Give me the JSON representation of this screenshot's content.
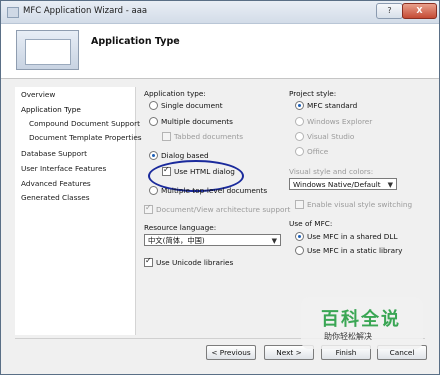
{
  "window": {
    "title": "MFC Application Wizard - aaa",
    "help_label": "?",
    "close_label": "X"
  },
  "header": {
    "title": "Application Type"
  },
  "nav": {
    "items": [
      {
        "label": "Overview"
      },
      {
        "label": "Application Type"
      },
      {
        "label": "Compound Document Support"
      },
      {
        "label": "Document Template Properties"
      },
      {
        "label": "Database Support"
      },
      {
        "label": "User Interface Features"
      },
      {
        "label": "Advanced Features"
      },
      {
        "label": "Generated Classes"
      }
    ]
  },
  "app_type": {
    "group_label": "Application type:",
    "single_label": "Single document",
    "multiple_label": "Multiple documents",
    "tabbed_label": "Tabbed documents",
    "dialog_label": "Dialog based",
    "html_dialog_label": "Use HTML dialog",
    "multiple_top_label": "Multiple top-level documents",
    "docview_label": "Document/View architecture support",
    "selected": "Dialog based",
    "html_dialog_checked": true,
    "docview_checked": true
  },
  "resource": {
    "label": "Resource language:",
    "value": "中文(简体，中国)"
  },
  "unicode": {
    "label": "Use Unicode libraries",
    "checked": true
  },
  "project_style": {
    "group_label": "Project style:",
    "options": [
      {
        "label": "MFC standard"
      },
      {
        "label": "Windows Explorer"
      },
      {
        "label": "Visual Studio"
      },
      {
        "label": "Office"
      }
    ],
    "selected": "MFC standard"
  },
  "visual": {
    "label": "Visual style and colors:",
    "value": "Windows Native/Default",
    "switching_label": "Enable visual style switching"
  },
  "use_mfc": {
    "group_label": "Use of MFC:",
    "shared_label": "Use MFC in a shared DLL",
    "static_label": "Use MFC in a static library",
    "selected": "Use MFC in a shared DLL"
  },
  "buttons": {
    "previous": "< Previous",
    "next": "Next >",
    "finish": "Finish",
    "cancel": "Cancel"
  },
  "watermark": {
    "title": "百科全说",
    "subtitle": "助你轻松解决"
  },
  "colors": {
    "accent": "#1d5fb7",
    "annotation": "#1a2a9c",
    "watermark": "#3aa654"
  }
}
